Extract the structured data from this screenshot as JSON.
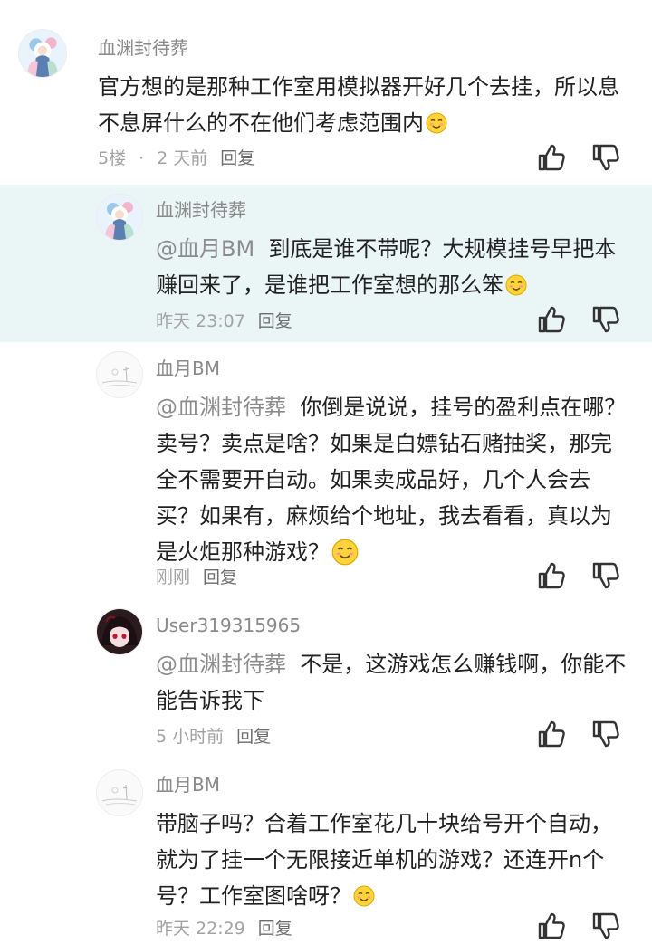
{
  "comments": [
    {
      "user": "血渊封待葬",
      "text": "官方想的是那种工作室用模拟器开好几个去挂，所以息不息屏什么的不在他们考虑范围内",
      "floor": "5楼",
      "separator": "·",
      "time": "2 天前",
      "reply": "回复",
      "emoji": "smile-emoji"
    },
    {
      "user": "血渊封待葬",
      "mention": "@血月BM",
      "text": "到底是谁不带呢？大规模挂号早把本赚回来了，是谁把工作室想的那么笨",
      "time": "昨天 23:07",
      "reply": "回复",
      "emoji": "smile-emoji"
    },
    {
      "user": "血月BM",
      "mention": "@血渊封待葬",
      "text": "你倒是说说，挂号的盈利点在哪？卖号？卖点是啥？如果是白嫖钻石赌抽奖，那完全不需要开自动。如果卖成品好，几个人会去买？如果有，麻烦给个地址，我去看看，真以为是火炬那种游戏？",
      "time": "刚刚",
      "reply": "回复",
      "emoji": "smile-emoji"
    },
    {
      "user": "User319315965",
      "mention": "@血渊封待葬",
      "text": "不是，这游戏怎么赚钱啊，你能不能告诉我下",
      "time": "5 小时前",
      "reply": "回复"
    },
    {
      "user": "血月BM",
      "text": "带脑子吗？合着工作室花几十块给号开个自动，就为了挂一个无限接近单机的游戏？还连开n个号？工作室图啥呀？",
      "time": "昨天 22:29",
      "reply": "回复",
      "emoji": "smile-emoji"
    }
  ],
  "icons": {
    "like": "thumbs-up-icon",
    "dislike": "thumbs-down-icon"
  },
  "colors": {
    "highlight_bg": "#e9f6f5",
    "name": "#8a8a8a",
    "mention": "#8c8c8c",
    "meta": "#a3a3a3"
  }
}
